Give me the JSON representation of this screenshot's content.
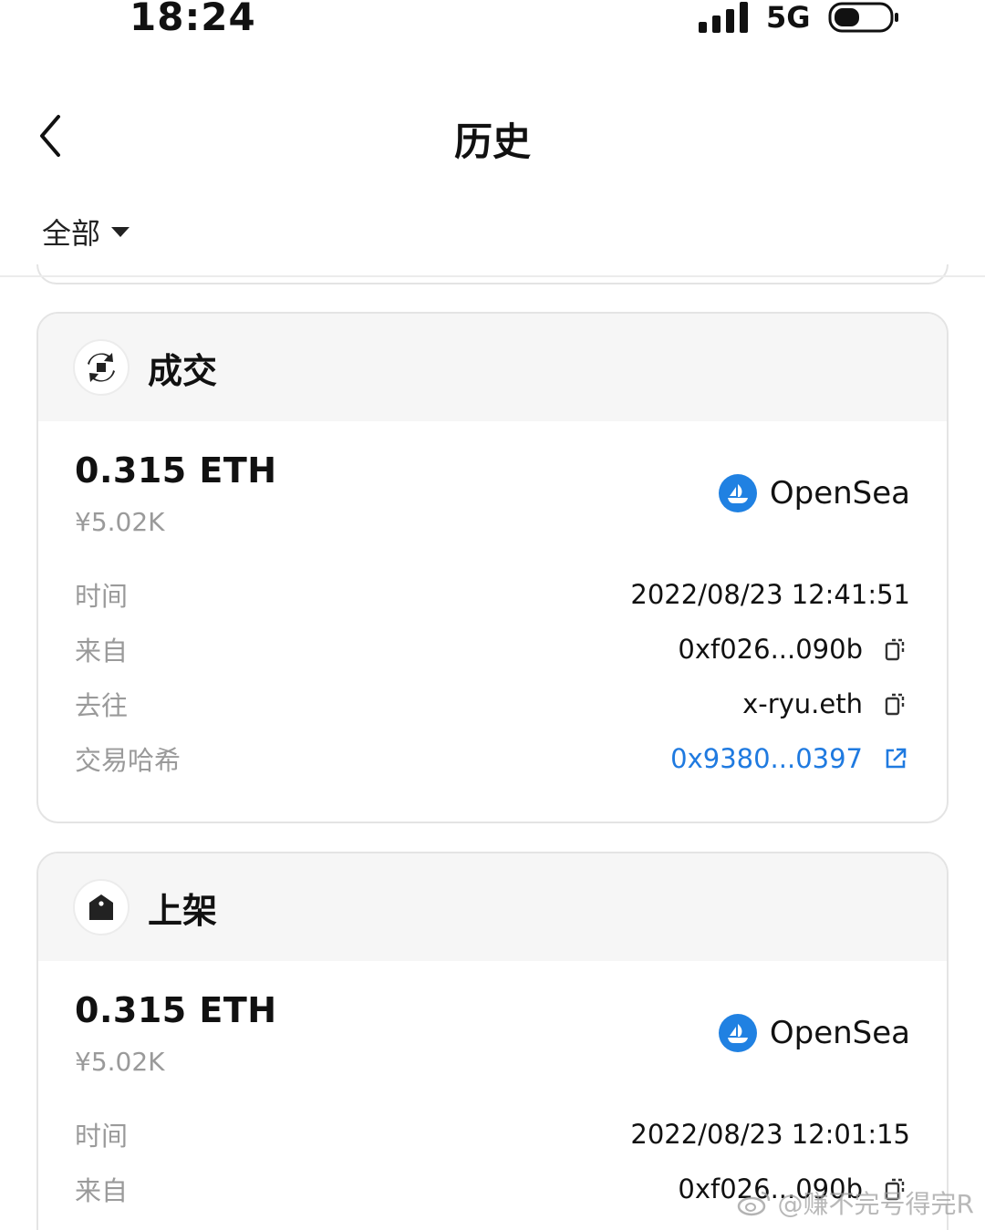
{
  "status_bar": {
    "time": "18:24",
    "network": "5G"
  },
  "nav": {
    "title": "历史"
  },
  "filter": {
    "label": "全部"
  },
  "cards": [
    {
      "type_label": "成交",
      "amount": "0.315 ETH",
      "fiat": "¥5.02K",
      "marketplace": "OpenSea",
      "rows": [
        {
          "label": "时间",
          "value": "2022/08/23 12:41:51"
        },
        {
          "label": "来自",
          "value": "0xf026...090b"
        },
        {
          "label": "去往",
          "value": "x-ryu.eth"
        },
        {
          "label": "交易哈希",
          "value": "0x9380...0397"
        }
      ]
    },
    {
      "type_label": "上架",
      "amount": "0.315 ETH",
      "fiat": "¥5.02K",
      "marketplace": "OpenSea",
      "rows": [
        {
          "label": "时间",
          "value": "2022/08/23 12:01:15"
        },
        {
          "label": "来自",
          "value": "0xf026...090b"
        }
      ]
    }
  ],
  "watermark": {
    "text": "@赚不完号得完R"
  },
  "colors": {
    "link": "#1f7ae0",
    "opensea": "#2081e2",
    "muted": "#9a9a9a"
  }
}
